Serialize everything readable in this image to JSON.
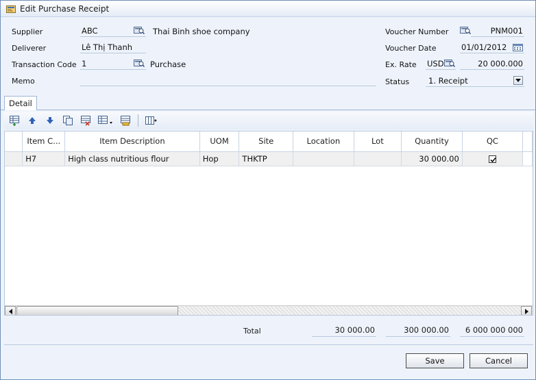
{
  "window": {
    "title": "Edit Purchase Receipt"
  },
  "header": {
    "supplier_label": "Supplier",
    "supplier_code": "ABC",
    "supplier_name": "Thai Binh shoe company",
    "deliverer_label": "Deliverer",
    "deliverer_value": "Lê Thị Thanh",
    "transaction_code_label": "Transaction Code",
    "transaction_code_value": "1",
    "transaction_type": "Purchase",
    "memo_label": "Memo",
    "memo_value": "",
    "voucher_number_label": "Voucher Number",
    "voucher_number_value": "PNM001",
    "voucher_date_label": "Voucher Date",
    "voucher_date_value": "01/01/2012",
    "ex_rate_label": "Ex. Rate",
    "currency": "USD",
    "ex_rate_value": "20 000.000",
    "status_label": "Status",
    "status_value": "1. Receipt"
  },
  "tabs": [
    {
      "label": "Detail"
    }
  ],
  "toolbar_icons": [
    "add-row-icon",
    "move-up-icon",
    "move-down-icon",
    "copy-icon",
    "delete-row-icon",
    "table-options-icon",
    "save-layout-icon",
    "columns-icon"
  ],
  "grid": {
    "columns": [
      "Item C...",
      "Item Description",
      "UOM",
      "Site",
      "Location",
      "Lot",
      "Quantity",
      "QC"
    ],
    "rows": [
      {
        "item_code": "H7",
        "description": "High class nutritious flour",
        "uom": "Hop",
        "site": "THKTP",
        "location": "",
        "lot": "",
        "quantity": "30 000.00",
        "qc": true
      }
    ]
  },
  "totals": {
    "label": "Total",
    "quantity": "30 000.00",
    "price": "300 000.00",
    "amount": "6 000 000 000"
  },
  "buttons": {
    "save": "Save",
    "cancel": "Cancel"
  }
}
